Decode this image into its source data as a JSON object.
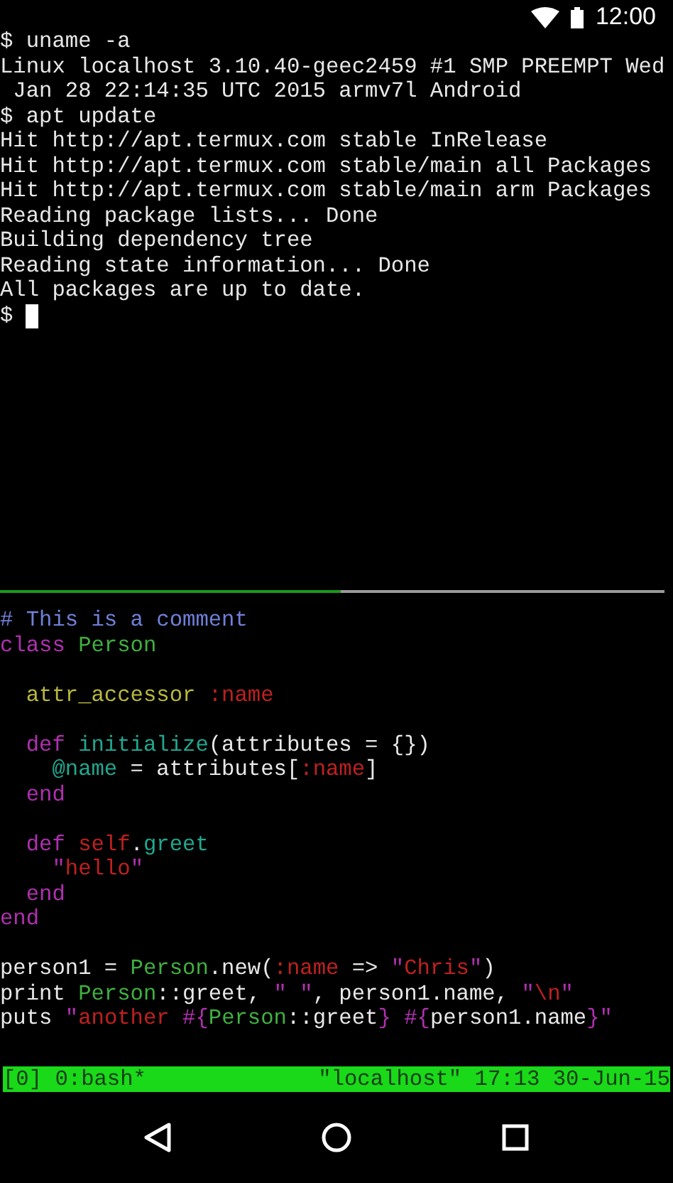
{
  "status_bar": {
    "time": "12:00"
  },
  "top_pane": {
    "active": false,
    "cursor": true,
    "lines": [
      "$ uname -a",
      "Linux localhost 3.10.40-geec2459 #1 SMP PREEMPT Wed",
      " Jan 28 22:14:35 UTC 2015 armv7l Android",
      "$ apt update",
      "Hit http://apt.termux.com stable InRelease",
      "Hit http://apt.termux.com stable/main all Packages",
      "Hit http://apt.termux.com stable/main arm Packages",
      "Reading package lists... Done",
      "Building dependency tree",
      "Reading state information... Done",
      "All packages are up to date.",
      "$"
    ]
  },
  "bottom_pane": {
    "active": true,
    "lines": [
      {
        "kind": "code",
        "tokens": [
          {
            "text": "# This is a comment",
            "color": "#7080d8"
          }
        ]
      },
      {
        "kind": "code",
        "tokens": [
          {
            "text": "class ",
            "color": "#b030b0"
          },
          {
            "text": "Person",
            "color": "#40b040"
          }
        ]
      },
      {
        "kind": "blank"
      },
      {
        "kind": "code",
        "tokens": [
          {
            "text": "  attr_accessor ",
            "color": "#b8b83c"
          },
          {
            "text": ":name",
            "color": "#c02020"
          }
        ]
      },
      {
        "kind": "blank"
      },
      {
        "kind": "code",
        "tokens": [
          {
            "text": "  def ",
            "color": "#b030b0"
          },
          {
            "text": "initialize",
            "color": "#20a890"
          },
          {
            "text": "(attributes = {})",
            "color": "#e8e8e8"
          }
        ]
      },
      {
        "kind": "code",
        "tokens": [
          {
            "text": "    @name",
            "color": "#20a890"
          },
          {
            "text": " = attributes[",
            "color": "#e8e8e8"
          },
          {
            "text": ":name",
            "color": "#c02020"
          },
          {
            "text": "]",
            "color": "#e8e8e8"
          }
        ]
      },
      {
        "kind": "code",
        "tokens": [
          {
            "text": "  end",
            "color": "#b030b0"
          }
        ]
      },
      {
        "kind": "blank"
      },
      {
        "kind": "code",
        "tokens": [
          {
            "text": "  def ",
            "color": "#b030b0"
          },
          {
            "text": "self",
            "color": "#c02020"
          },
          {
            "text": ".",
            "color": "#e8e8e8"
          },
          {
            "text": "greet",
            "color": "#20a890"
          }
        ]
      },
      {
        "kind": "code",
        "tokens": [
          {
            "text": "    \"",
            "color": "#b030b0"
          },
          {
            "text": "hello",
            "color": "#c02020"
          },
          {
            "text": "\"",
            "color": "#b030b0"
          }
        ]
      },
      {
        "kind": "code",
        "tokens": [
          {
            "text": "  end",
            "color": "#b030b0"
          }
        ]
      },
      {
        "kind": "code",
        "tokens": [
          {
            "text": "end",
            "color": "#b030b0"
          }
        ]
      },
      {
        "kind": "blank"
      },
      {
        "kind": "code",
        "tokens": [
          {
            "text": "person1 = ",
            "color": "#e8e8e8"
          },
          {
            "text": "Person",
            "color": "#40b040"
          },
          {
            "text": ".new(",
            "color": "#e8e8e8"
          },
          {
            "text": ":name",
            "color": "#c02020"
          },
          {
            "text": " => ",
            "color": "#e8e8e8"
          },
          {
            "text": "\"",
            "color": "#b030b0"
          },
          {
            "text": "Chris",
            "color": "#c02020"
          },
          {
            "text": "\"",
            "color": "#b030b0"
          },
          {
            "text": ")",
            "color": "#e8e8e8"
          }
        ]
      },
      {
        "kind": "code",
        "tokens": [
          {
            "text": "print ",
            "color": "#e8e8e8"
          },
          {
            "text": "Person",
            "color": "#40b040"
          },
          {
            "text": "::greet, ",
            "color": "#e8e8e8"
          },
          {
            "text": "\" \"",
            "color": "#b030b0"
          },
          {
            "text": ", person1.name, ",
            "color": "#e8e8e8"
          },
          {
            "text": "\"",
            "color": "#b030b0"
          },
          {
            "text": "\\n",
            "color": "#c02020"
          },
          {
            "text": "\"",
            "color": "#b030b0"
          }
        ]
      },
      {
        "kind": "code",
        "tokens": [
          {
            "text": "puts ",
            "color": "#e8e8e8"
          },
          {
            "text": "\"",
            "color": "#b030b0"
          },
          {
            "text": "another ",
            "color": "#c02020"
          },
          {
            "text": "#{",
            "color": "#b030b0"
          },
          {
            "text": "Person",
            "color": "#40b040"
          },
          {
            "text": "::greet",
            "color": "#e8e8e8"
          },
          {
            "text": "} ",
            "color": "#b030b0"
          },
          {
            "text": "#{",
            "color": "#b030b0"
          },
          {
            "text": "person1.name",
            "color": "#e8e8e8"
          },
          {
            "text": "}",
            "color": "#b030b0"
          },
          {
            "text": "\"",
            "color": "#b030b0"
          }
        ]
      }
    ]
  },
  "tmux_status": {
    "left": "[0] 0:bash*",
    "right": "\"localhost\" 17:13 30-Jun-15"
  }
}
